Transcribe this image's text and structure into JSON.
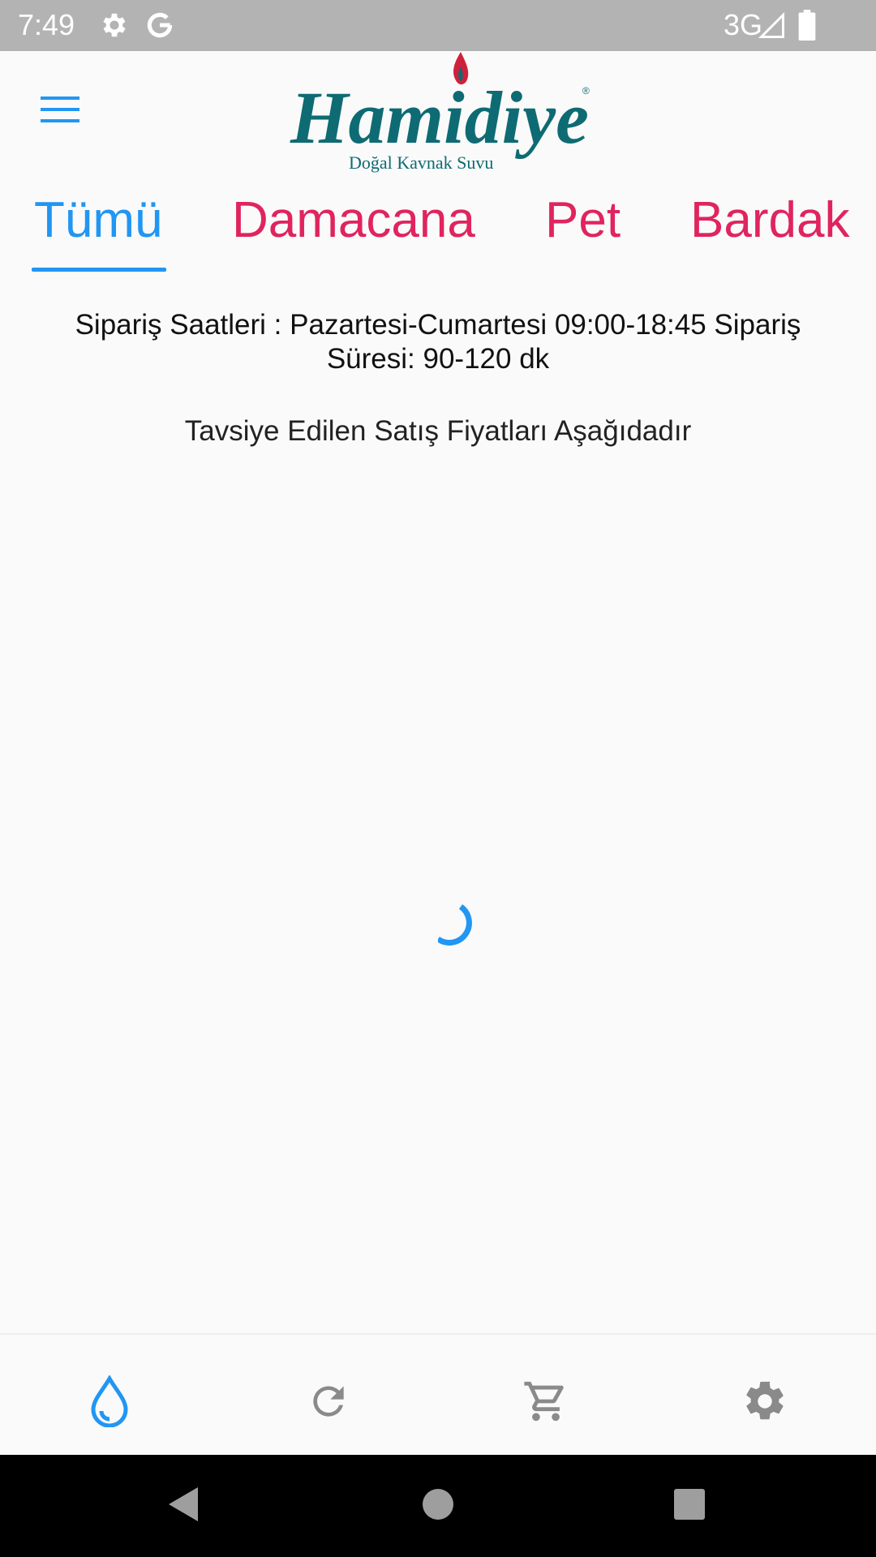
{
  "status_bar": {
    "time": "7:49",
    "network": "3G",
    "icons": [
      "settings-icon",
      "google-icon",
      "signal-icon",
      "battery-icon"
    ]
  },
  "app_bar": {
    "menu_icon": "hamburger-menu-icon",
    "logo_brand": "Hamidiye",
    "logo_tagline": "Doğal Kavnak Suvu"
  },
  "tabs": [
    {
      "label": "Tümü",
      "active": true
    },
    {
      "label": "Damacana",
      "active": false
    },
    {
      "label": "Pet",
      "active": false
    },
    {
      "label": "Bardak",
      "active": false
    }
  ],
  "info": {
    "order_hours": "Sipariş Saatleri : Pazartesi-Cumartesi 09:00-18:45 Sipariş Süresi: 90-120 dk",
    "recommended_prices": "Tavsiye Edilen Satış Fiyatları Aşağıdadır"
  },
  "bottom_nav": [
    {
      "icon": "water-drop-icon",
      "active": true
    },
    {
      "icon": "refresh-icon",
      "active": false
    },
    {
      "icon": "cart-icon",
      "active": false
    },
    {
      "icon": "settings-icon",
      "active": false
    }
  ],
  "system_nav": [
    "back-icon",
    "home-icon",
    "recents-icon"
  ],
  "colors": {
    "accent": "#2196f3",
    "tab_inactive": "#e0245e",
    "logo_teal": "#0e6b73",
    "logo_red": "#d0213a",
    "status_bar": "#b3b3b3",
    "nav_icon": "#8a8a8a"
  }
}
